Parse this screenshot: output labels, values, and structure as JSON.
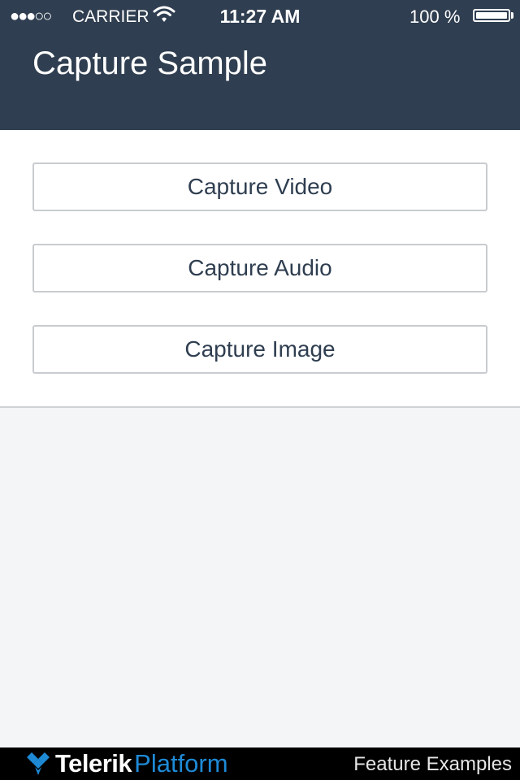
{
  "status_bar": {
    "signal": "●●●○○",
    "carrier": "CARRIER",
    "time": "11:27 AM",
    "battery": "100 %",
    "battery_level": 1.0
  },
  "header": {
    "title": "Capture Sample",
    "background": "#2f3e50"
  },
  "buttons": {
    "video": "Capture Video",
    "audio": "Capture Audio",
    "image": "Capture Image"
  },
  "footer": {
    "logo_word1": "Telerik",
    "logo_word2": "Platform",
    "link": "Feature Examples",
    "brand_color": "#1e8ad6"
  }
}
